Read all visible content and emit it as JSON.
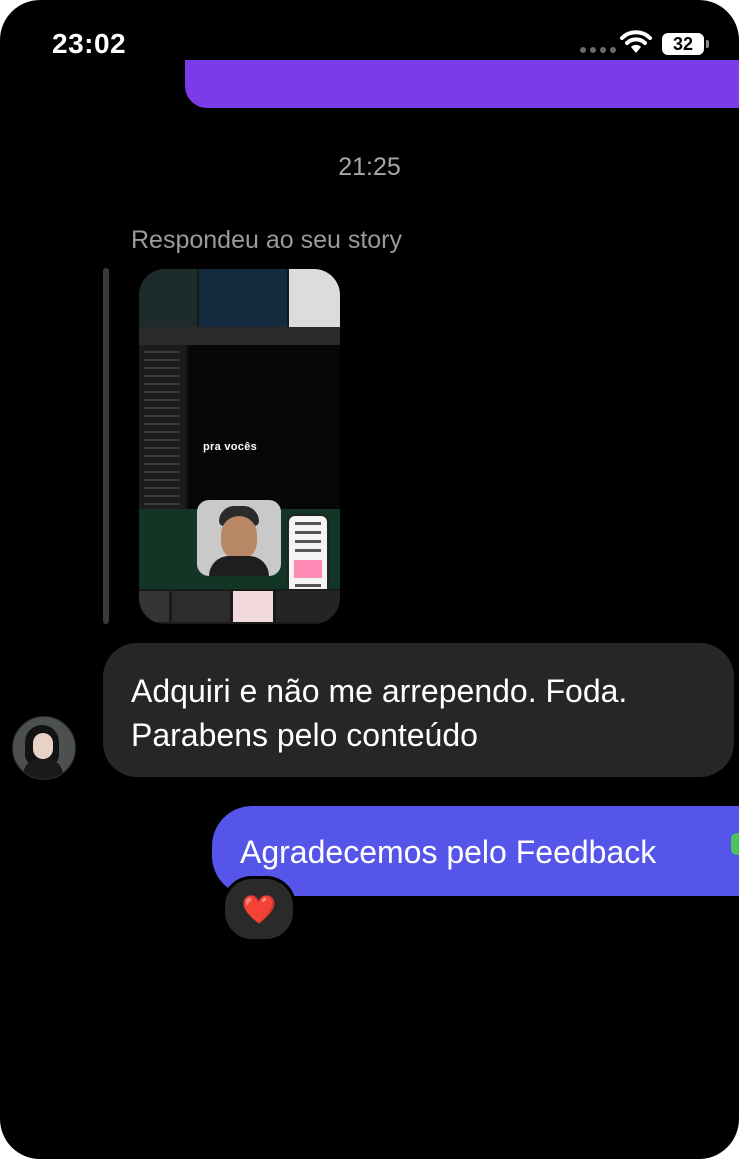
{
  "status_bar": {
    "time": "23:02",
    "battery": "32",
    "icons": [
      "cellular-signal-icon",
      "wifi-icon",
      "battery-icon"
    ]
  },
  "chat": {
    "timestamp": "21:25",
    "reply_label": "Respondeu ao seu story",
    "story_preview": {
      "overlay_text": "pra vocês"
    },
    "incoming_message": {
      "lines": [
        "Adquiri e não me arrependo. Foda.",
        "Parabens pelo conteúdo"
      ]
    },
    "outgoing_message": {
      "text": "Agradecemos pelo Feedback",
      "reaction": "❤️"
    }
  },
  "colors": {
    "background": "#000000",
    "incoming_bubble": "#262626",
    "outgoing_bubble": "#5555e9",
    "previous_bubble": "#7c3be8",
    "secondary_text": "#a7a7a7"
  }
}
